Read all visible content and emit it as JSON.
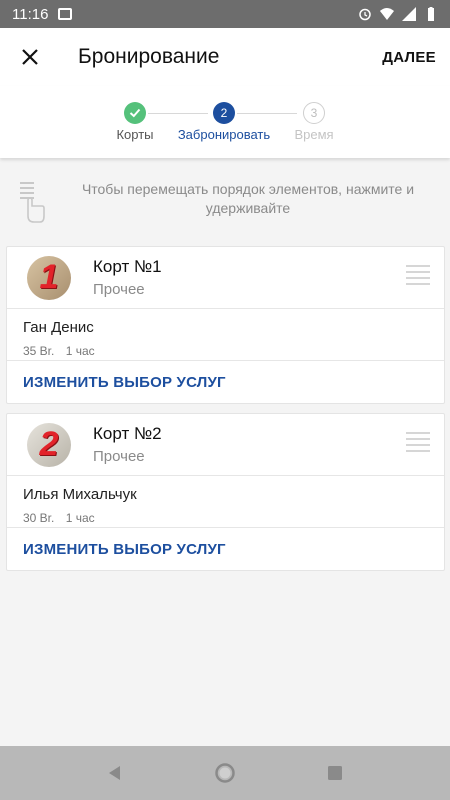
{
  "status_bar": {
    "time": "11:16"
  },
  "app_bar": {
    "title": "Бронирование",
    "next_label": "ДАЛЕЕ"
  },
  "stepper": {
    "steps": [
      {
        "number": "✓",
        "label": "Корты",
        "state": "done"
      },
      {
        "number": "2",
        "label": "Забронировать",
        "state": "active"
      },
      {
        "number": "3",
        "label": "Время",
        "state": "pending"
      }
    ]
  },
  "hint": {
    "text": "Чтобы перемещать порядок элементов, нажмите и удерживайте"
  },
  "bookings": [
    {
      "avatar_number": "1",
      "court_name": "Корт №1",
      "court_type": "Прочее",
      "person": "Ган Денис",
      "price": "35 Br.",
      "duration": "1 час",
      "action_label": "ИЗМЕНИТЬ ВЫБОР УСЛУГ"
    },
    {
      "avatar_number": "2",
      "court_name": "Корт №2",
      "court_type": "Прочее",
      "person": "Илья Михальчук",
      "price": "30 Br.",
      "duration": "1 час",
      "action_label": "ИЗМЕНИТЬ ВЫБОР УСЛУГ"
    }
  ],
  "colors": {
    "accent": "#1d4f9f",
    "done": "#55c17b"
  }
}
